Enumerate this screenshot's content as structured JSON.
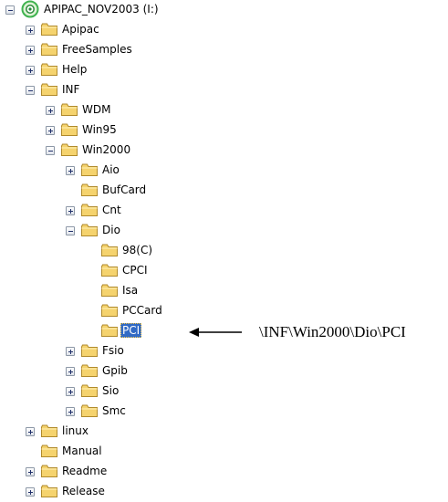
{
  "tree": {
    "root": {
      "label": "APIPAC_NOV2003 (I:)",
      "icon": "cd-drive-icon",
      "state": "expanded"
    },
    "nodes": [
      {
        "id": "apipac",
        "label": "Apipac",
        "depth": 1,
        "toggle": "plus"
      },
      {
        "id": "freesamples",
        "label": "FreeSamples",
        "depth": 1,
        "toggle": "plus"
      },
      {
        "id": "help",
        "label": "Help",
        "depth": 1,
        "toggle": "plus"
      },
      {
        "id": "inf",
        "label": "INF",
        "depth": 1,
        "toggle": "minus"
      },
      {
        "id": "wdm",
        "label": "WDM",
        "depth": 2,
        "toggle": "plus"
      },
      {
        "id": "win95",
        "label": "Win95",
        "depth": 2,
        "toggle": "plus"
      },
      {
        "id": "win2000",
        "label": "Win2000",
        "depth": 2,
        "toggle": "minus"
      },
      {
        "id": "aio",
        "label": "Aio",
        "depth": 3,
        "toggle": "plus"
      },
      {
        "id": "bufcard",
        "label": "BufCard",
        "depth": 3,
        "toggle": "none"
      },
      {
        "id": "cnt",
        "label": "Cnt",
        "depth": 3,
        "toggle": "plus"
      },
      {
        "id": "dio",
        "label": "Dio",
        "depth": 3,
        "toggle": "minus"
      },
      {
        "id": "98c",
        "label": "98(C)",
        "depth": 4,
        "toggle": "none"
      },
      {
        "id": "cpci",
        "label": "CPCI",
        "depth": 4,
        "toggle": "none"
      },
      {
        "id": "isa",
        "label": "Isa",
        "depth": 4,
        "toggle": "none"
      },
      {
        "id": "pccard",
        "label": "PCCard",
        "depth": 4,
        "toggle": "none"
      },
      {
        "id": "pci",
        "label": "PCI",
        "depth": 4,
        "toggle": "none",
        "selected": true
      },
      {
        "id": "fsio",
        "label": "Fsio",
        "depth": 3,
        "toggle": "plus"
      },
      {
        "id": "gpib",
        "label": "Gpib",
        "depth": 3,
        "toggle": "plus"
      },
      {
        "id": "sio",
        "label": "Sio",
        "depth": 3,
        "toggle": "plus"
      },
      {
        "id": "smc",
        "label": "Smc",
        "depth": 3,
        "toggle": "plus"
      },
      {
        "id": "linux",
        "label": "linux",
        "depth": 1,
        "toggle": "plus"
      },
      {
        "id": "manual",
        "label": "Manual",
        "depth": 1,
        "toggle": "none"
      },
      {
        "id": "readme",
        "label": "Readme",
        "depth": 1,
        "toggle": "plus"
      },
      {
        "id": "release",
        "label": "Release",
        "depth": 1,
        "toggle": "plus"
      }
    ]
  },
  "annotation": {
    "path": "\\INF\\Win2000\\Dio\\PCI",
    "icon": "left-arrow-icon"
  },
  "colors": {
    "selection_bg": "#316ac5",
    "selection_text": "#ffffff",
    "folder_fill": "#f5d36e",
    "folder_stroke": "#b08a2c",
    "drive_ring": "#3fb34f"
  }
}
